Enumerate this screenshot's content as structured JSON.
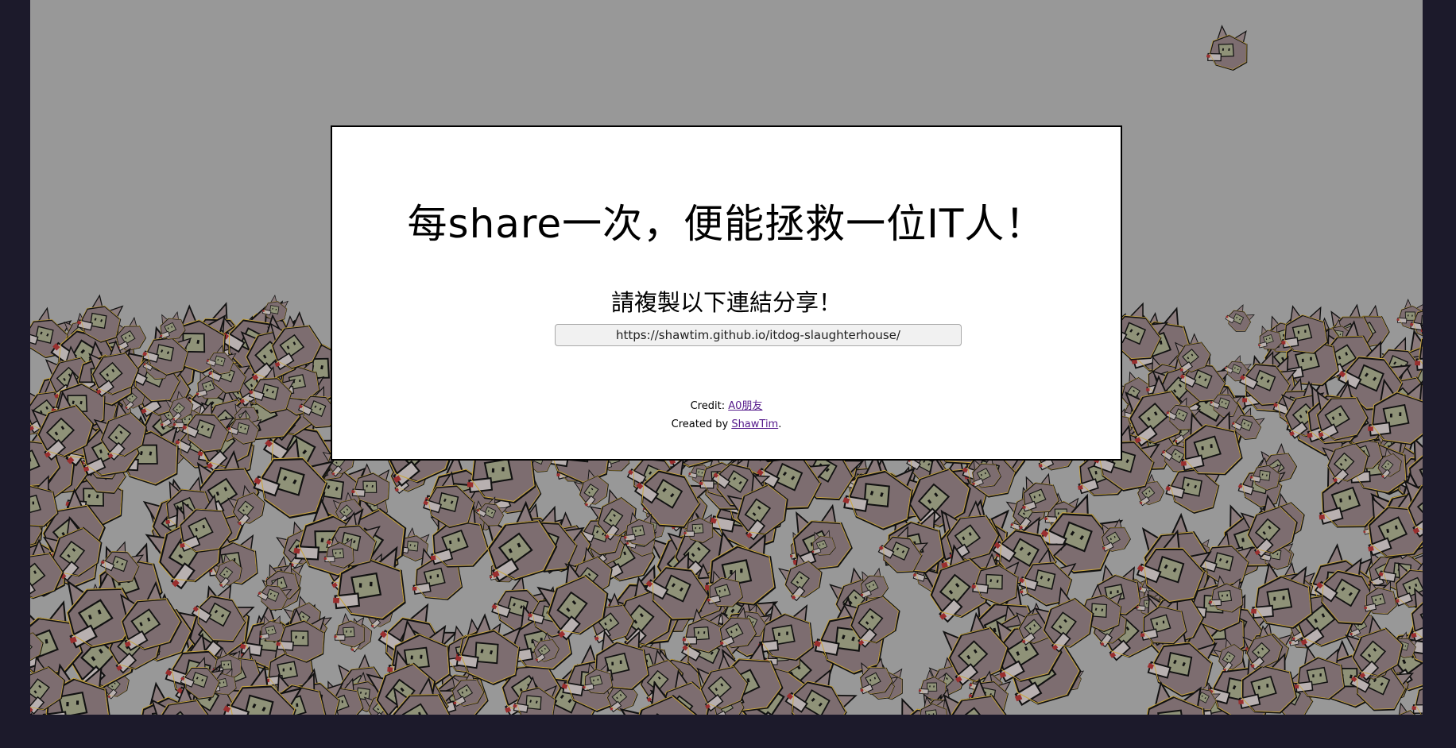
{
  "dialog": {
    "headline": "每share一次，便能拯救一位IT人！",
    "copy_prompt": "請複製以下連結分享！",
    "share_url": "https://shawtim.github.io/itdog-slaughterhouse/",
    "credit_prefix": "Credit: ",
    "credit_link": "A0朋友",
    "created_prefix": "Created by ",
    "created_link": "ShawTim",
    "created_suffix": "."
  },
  "background": {
    "icon": "it-dog-head-icon",
    "colors": {
      "page": "#1c1a2b",
      "stage": "#989898",
      "dog_fur": "#7a6a6a",
      "dog_face": "#8f9278",
      "dog_outline": "#c9a640"
    }
  }
}
